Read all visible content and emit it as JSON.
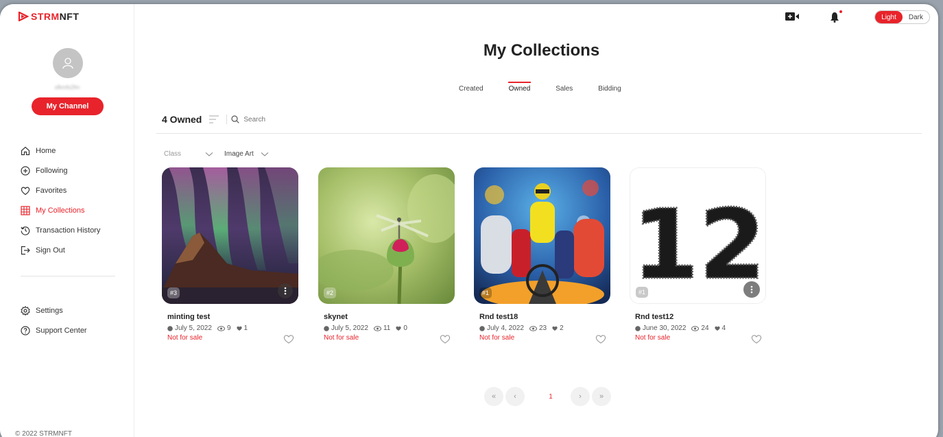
{
  "brand": {
    "logo_text_red": "STRM",
    "logo_text_dark": "NFT",
    "accent": "#e8232b"
  },
  "sidebar": {
    "username": "sfkmfs2fm",
    "channel_button": "My Channel",
    "items": [
      {
        "label": "Home",
        "icon": "home-icon"
      },
      {
        "label": "Following",
        "icon": "plus-circle-icon"
      },
      {
        "label": "Favorites",
        "icon": "heart-icon"
      },
      {
        "label": "My Collections",
        "icon": "grid-icon",
        "active": true
      },
      {
        "label": "Transaction History",
        "icon": "history-icon"
      },
      {
        "label": "Sign Out",
        "icon": "sign-out-icon"
      }
    ],
    "bottom_items": [
      {
        "label": "Settings",
        "icon": "gear-icon"
      },
      {
        "label": "Support Center",
        "icon": "help-icon"
      }
    ],
    "copyright": "© 2022 STRMNFT"
  },
  "topbar": {
    "theme_light": "Light",
    "theme_dark": "Dark"
  },
  "page": {
    "title": "My Collections",
    "tabs": [
      "Created",
      "Owned",
      "Sales",
      "Bidding"
    ],
    "active_tab": "Owned",
    "owned_count": "4 Owned",
    "search_placeholder": "Search",
    "filter_class": "Class",
    "filter_type": "Image Art"
  },
  "cards": [
    {
      "badge": "#3",
      "name": "minting test",
      "date": "July 5, 2022",
      "views": "9",
      "likes": "1",
      "status": "Not for sale"
    },
    {
      "badge": "#2",
      "name": "skynet",
      "date": "July 5, 2022",
      "views": "11",
      "likes": "0",
      "status": "Not for sale"
    },
    {
      "badge": "#1",
      "name": "Rnd test18",
      "date": "July 4, 2022",
      "views": "23",
      "likes": "2",
      "status": "Not for sale"
    },
    {
      "badge": "#1",
      "name": "Rnd test12",
      "date": "June 30, 2022",
      "views": "24",
      "likes": "4",
      "status": "Not for sale",
      "art_text": "12"
    }
  ],
  "pagination": {
    "first": "«",
    "prev": "‹",
    "current": "1",
    "next": "›",
    "last": "»"
  }
}
